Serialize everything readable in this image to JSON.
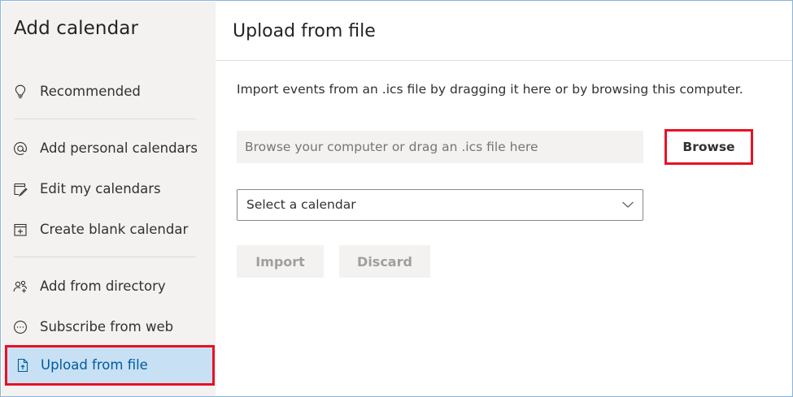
{
  "sidebar": {
    "title": "Add calendar",
    "items": [
      {
        "label": "Recommended",
        "icon": "lightbulb-icon"
      },
      {
        "label": "Add personal calendars",
        "icon": "at-sign-icon"
      },
      {
        "label": "Edit my calendars",
        "icon": "edit-calendar-icon"
      },
      {
        "label": "Create blank calendar",
        "icon": "calendar-add-icon"
      },
      {
        "label": "Add from directory",
        "icon": "people-add-icon"
      },
      {
        "label": "Subscribe from web",
        "icon": "subscribe-icon"
      },
      {
        "label": "Upload from file",
        "icon": "file-upload-icon",
        "active": true
      }
    ]
  },
  "main": {
    "title": "Upload from file",
    "description": "Import events from an .ics file by dragging it here or by browsing this computer.",
    "file_input": {
      "placeholder": "Browse your computer or drag an .ics file here"
    },
    "browse_label": "Browse",
    "calendar_select": {
      "value": "Select a calendar"
    },
    "import_label": "Import",
    "discard_label": "Discard"
  },
  "colors": {
    "accent": "#005a9e",
    "active_bg": "#c7e0f4",
    "highlight_border": "#e81123",
    "sidebar_bg": "#f3f2f1"
  }
}
